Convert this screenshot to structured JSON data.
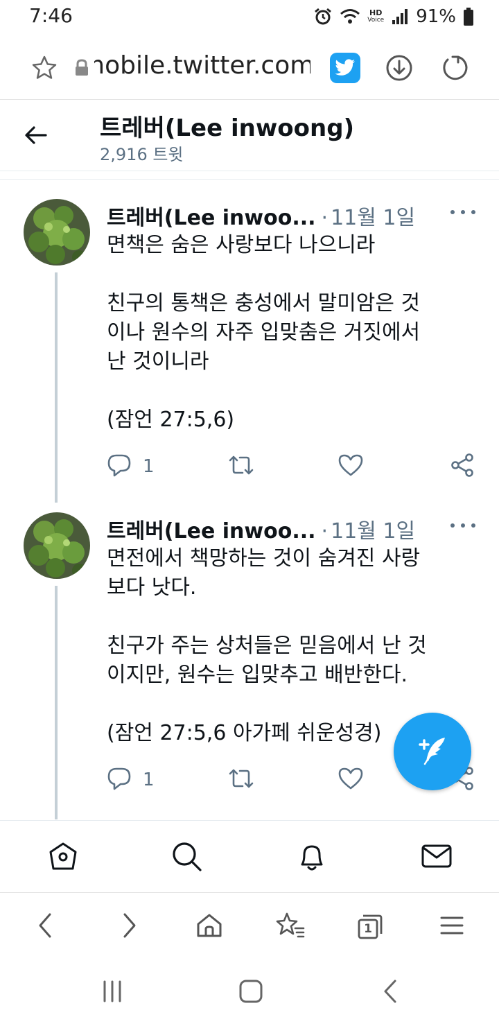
{
  "status_bar": {
    "time": "7:46",
    "battery": "91%",
    "hd_label": "HD",
    "voice_label": "Voice"
  },
  "browser": {
    "url": "mobile.twitter.com"
  },
  "profile": {
    "name": "트레버(Lee inwoong)",
    "tweet_count": "2,916 트윗"
  },
  "tweets": [
    {
      "author": "트레버(Lee inwoo...",
      "separator": "·",
      "date": "11월 1일",
      "lines": [
        "면책은 숨은 사랑보다 나으니라",
        "",
        "친구의 통책은 충성에서 말미암은 것",
        "이나 원수의 자주 입맞춤은 거짓에서",
        "난 것이니라",
        "",
        "(잠언 27:5,6)"
      ],
      "reply_count": "1"
    },
    {
      "author": "트레버(Lee inwoo...",
      "separator": "·",
      "date": "11월 1일",
      "lines": [
        "면전에서 책망하는 것이 숨겨진 사랑",
        "보다 낫다.",
        "",
        "친구가 주는 상처들은 믿음에서 난 것",
        "이지만, 원수는 입맞추고 배반한다.",
        "",
        "(잠언 27:5,6 아가페 쉬운성경)"
      ],
      "reply_count": "1"
    }
  ],
  "colors": {
    "accent": "#1da1f2",
    "text_secondary": "#5b7083"
  },
  "icons": {
    "tabs": [
      "home-icon",
      "search-icon",
      "bell-icon",
      "mail-icon"
    ],
    "browser_nav": [
      "back-icon",
      "forward-icon",
      "home-icon",
      "bookmarks-icon",
      "tabs-icon",
      "menu-icon"
    ]
  },
  "browser_nav": {
    "tabs_count": "1"
  }
}
